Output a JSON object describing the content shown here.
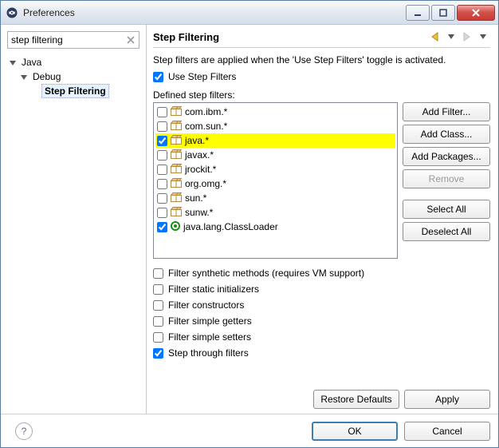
{
  "window": {
    "title": "Preferences"
  },
  "search": {
    "value": "step filtering",
    "placeholder": ""
  },
  "tree": {
    "java": "Java",
    "debug": "Debug",
    "stepfiltering": "Step Filtering"
  },
  "page": {
    "title": "Step Filtering",
    "desc": "Step filters are applied when the 'Use Step Filters' toggle is activated.",
    "use_step_filters": "Use Step Filters",
    "defined_label": "Defined step filters:",
    "filters": [
      {
        "checked": false,
        "kind": "pkg",
        "label": "com.ibm.*",
        "hl": false
      },
      {
        "checked": false,
        "kind": "pkg",
        "label": "com.sun.*",
        "hl": false
      },
      {
        "checked": true,
        "kind": "pkg",
        "label": "java.*",
        "hl": true
      },
      {
        "checked": false,
        "kind": "pkg",
        "label": "javax.*",
        "hl": false
      },
      {
        "checked": false,
        "kind": "pkg",
        "label": "jrockit.*",
        "hl": false
      },
      {
        "checked": false,
        "kind": "pkg",
        "label": "org.omg.*",
        "hl": false
      },
      {
        "checked": false,
        "kind": "pkg",
        "label": "sun.*",
        "hl": false
      },
      {
        "checked": false,
        "kind": "pkg",
        "label": "sunw.*",
        "hl": false
      },
      {
        "checked": true,
        "kind": "cls",
        "label": "java.lang.ClassLoader",
        "hl": false
      }
    ],
    "btns": {
      "add_filter": "Add Filter...",
      "add_class": "Add Class...",
      "add_packages": "Add Packages...",
      "remove": "Remove",
      "select_all": "Select All",
      "deselect_all": "Deselect All"
    },
    "opts": {
      "synthetic": "Filter synthetic methods (requires VM support)",
      "static_init": "Filter static initializers",
      "constructors": "Filter constructors",
      "simple_getters": "Filter simple getters",
      "simple_setters": "Filter simple setters",
      "step_through": "Step through filters"
    },
    "restore": "Restore Defaults",
    "apply": "Apply",
    "ok": "OK",
    "cancel": "Cancel"
  }
}
